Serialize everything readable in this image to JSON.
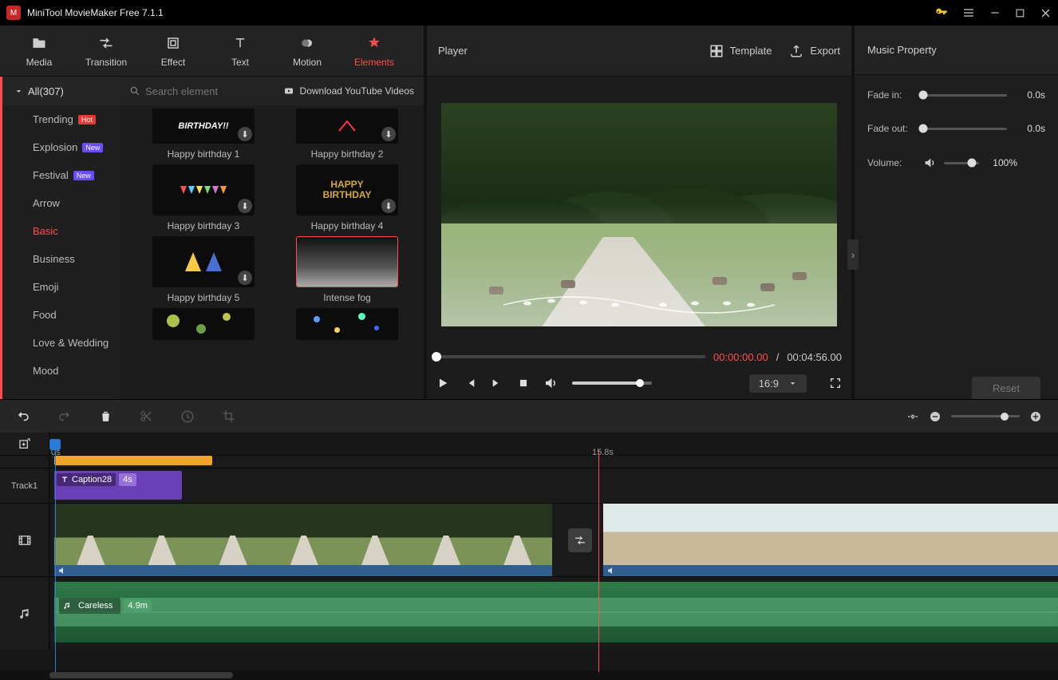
{
  "titlebar": {
    "app_title": "MiniTool MovieMaker Free 7.1.1"
  },
  "tabs": {
    "media": "Media",
    "transition": "Transition",
    "effect": "Effect",
    "text": "Text",
    "motion": "Motion",
    "elements": "Elements"
  },
  "sidebar": {
    "all_label": "All(307)",
    "items": [
      {
        "label": "Trending",
        "badge": "Hot",
        "badge_kind": "hot"
      },
      {
        "label": "Explosion",
        "badge": "New",
        "badge_kind": "new"
      },
      {
        "label": "Festival",
        "badge": "New",
        "badge_kind": "new"
      },
      {
        "label": "Arrow"
      },
      {
        "label": "Basic",
        "active": true
      },
      {
        "label": "Business"
      },
      {
        "label": "Emoji"
      },
      {
        "label": "Food"
      },
      {
        "label": "Love & Wedding"
      },
      {
        "label": "Mood"
      }
    ]
  },
  "search": {
    "placeholder": "Search element"
  },
  "yt_link": "Download YouTube Videos",
  "elements": {
    "hb1": "Happy birthday 1",
    "hb2": "Happy birthday 2",
    "hb3": "Happy birthday 3",
    "hb4": "Happy birthday 4",
    "hb5": "Happy birthday 5",
    "fog": "Intense fog",
    "hb4_text_top": "HAPPY",
    "hb4_text_bot": "BIRTHDAY",
    "hb1_text": "BIRTHDAY!!"
  },
  "player": {
    "title": "Player",
    "template": "Template",
    "export": "Export",
    "time_current": "00:00:00.00",
    "time_sep": " / ",
    "time_total": "00:04:56.00",
    "aspect": "16:9"
  },
  "props": {
    "title": "Music Property",
    "fade_in_label": "Fade in:",
    "fade_in_value": "0.0s",
    "fade_out_label": "Fade out:",
    "fade_out_value": "0.0s",
    "volume_label": "Volume:",
    "volume_value": "100%",
    "reset": "Reset"
  },
  "timeline": {
    "ruler_start": "0s",
    "ruler_mid": "15.8s",
    "track1_label": "Track1",
    "caption_name": "Caption28",
    "caption_dur": "4s",
    "music_name": "Careless",
    "music_dur": "4.9m"
  }
}
